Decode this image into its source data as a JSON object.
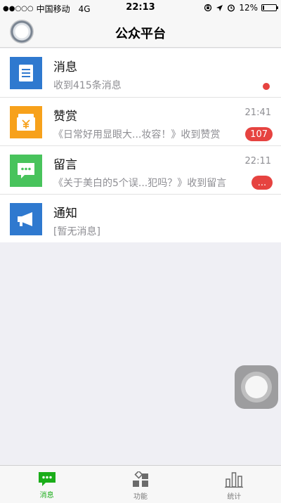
{
  "status_bar": {
    "signal": "●●○○○",
    "carrier": "中国移动",
    "network": "4G",
    "time": "22:13",
    "battery": "12%",
    "battery_level": 0.12
  },
  "nav": {
    "title": "公众平台"
  },
  "rows": [
    {
      "name": "消息",
      "subtitle": "收到415条消息",
      "time": "",
      "badge": "",
      "icon": "document-icon",
      "color": "#2f79cf"
    },
    {
      "name": "赞赏",
      "subtitle": "《日常好用显眼大...妆容！》收到赞赏",
      "time": "21:41",
      "badge": "107",
      "icon": "money-box-icon",
      "color": "#f7a11b"
    },
    {
      "name": "留言",
      "subtitle": "《关于美白的5个误...犯吗？》收到留言",
      "time": "22:11",
      "badge": "...",
      "icon": "chat-bubble-icon",
      "color": "#48c35c"
    },
    {
      "name": "通知",
      "subtitle": "[暂无消息]",
      "time": "",
      "badge": "",
      "icon": "megaphone-icon",
      "color": "#2f79cf"
    }
  ],
  "tabs": [
    {
      "label": "消息",
      "icon": "chat-icon",
      "active": true
    },
    {
      "label": "功能",
      "icon": "grid-icon",
      "active": false
    },
    {
      "label": "统计",
      "icon": "bar-chart-icon",
      "active": false
    }
  ],
  "colors": {
    "accent_green": "#1aad19",
    "badge_red": "#e64340"
  }
}
